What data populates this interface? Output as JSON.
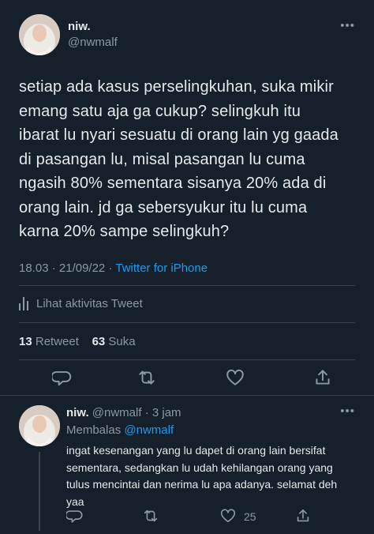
{
  "tweet": {
    "author_name": "niw.",
    "author_handle": "@nwmalf",
    "text": "setiap ada kasus perselingkuhan, suka mikir\nemang satu aja ga cukup? selingkuh itu\nibarat lu nyari sesuatu di orang lain yg gaada\ndi pasangan lu, misal pasangan lu cuma\nngasih 80% sementara sisanya 20% ada di\norang lain. jd ga sebersyukur itu lu cuma\nkarna 20% sampe selingkuh?",
    "time": "18.03",
    "date": "21/09/22",
    "source": "Twitter for iPhone",
    "activity_label": "Lihat aktivitas Tweet",
    "retweet_count": "13",
    "retweet_label": "Retweet",
    "like_count": "63",
    "like_label": "Suka"
  },
  "reply": {
    "author_name": "niw.",
    "author_handle": "@nwmalf",
    "age": "3 jam",
    "replying_label": "Membalas",
    "replying_to": "@nwmalf",
    "text": "ingat kesenangan yang lu dapet di orang lain bersifat\nsementara, sedangkan lu udah kehilangan orang yang\ntulus mencintai dan nerima lu apa adanya. selamat deh\nyaa",
    "like_count": "25"
  },
  "icons": {
    "more": "more-horizontal-icon",
    "activity": "bar-chart-icon",
    "reply": "speech-bubble-icon",
    "retweet": "retweet-arrows-icon",
    "like": "heart-icon",
    "share": "share-upload-icon"
  },
  "colors": {
    "background": "#15202b",
    "text": "#e7e9ea",
    "muted": "#8b98a5",
    "link": "#1d9bf0",
    "divider": "#38444d"
  }
}
